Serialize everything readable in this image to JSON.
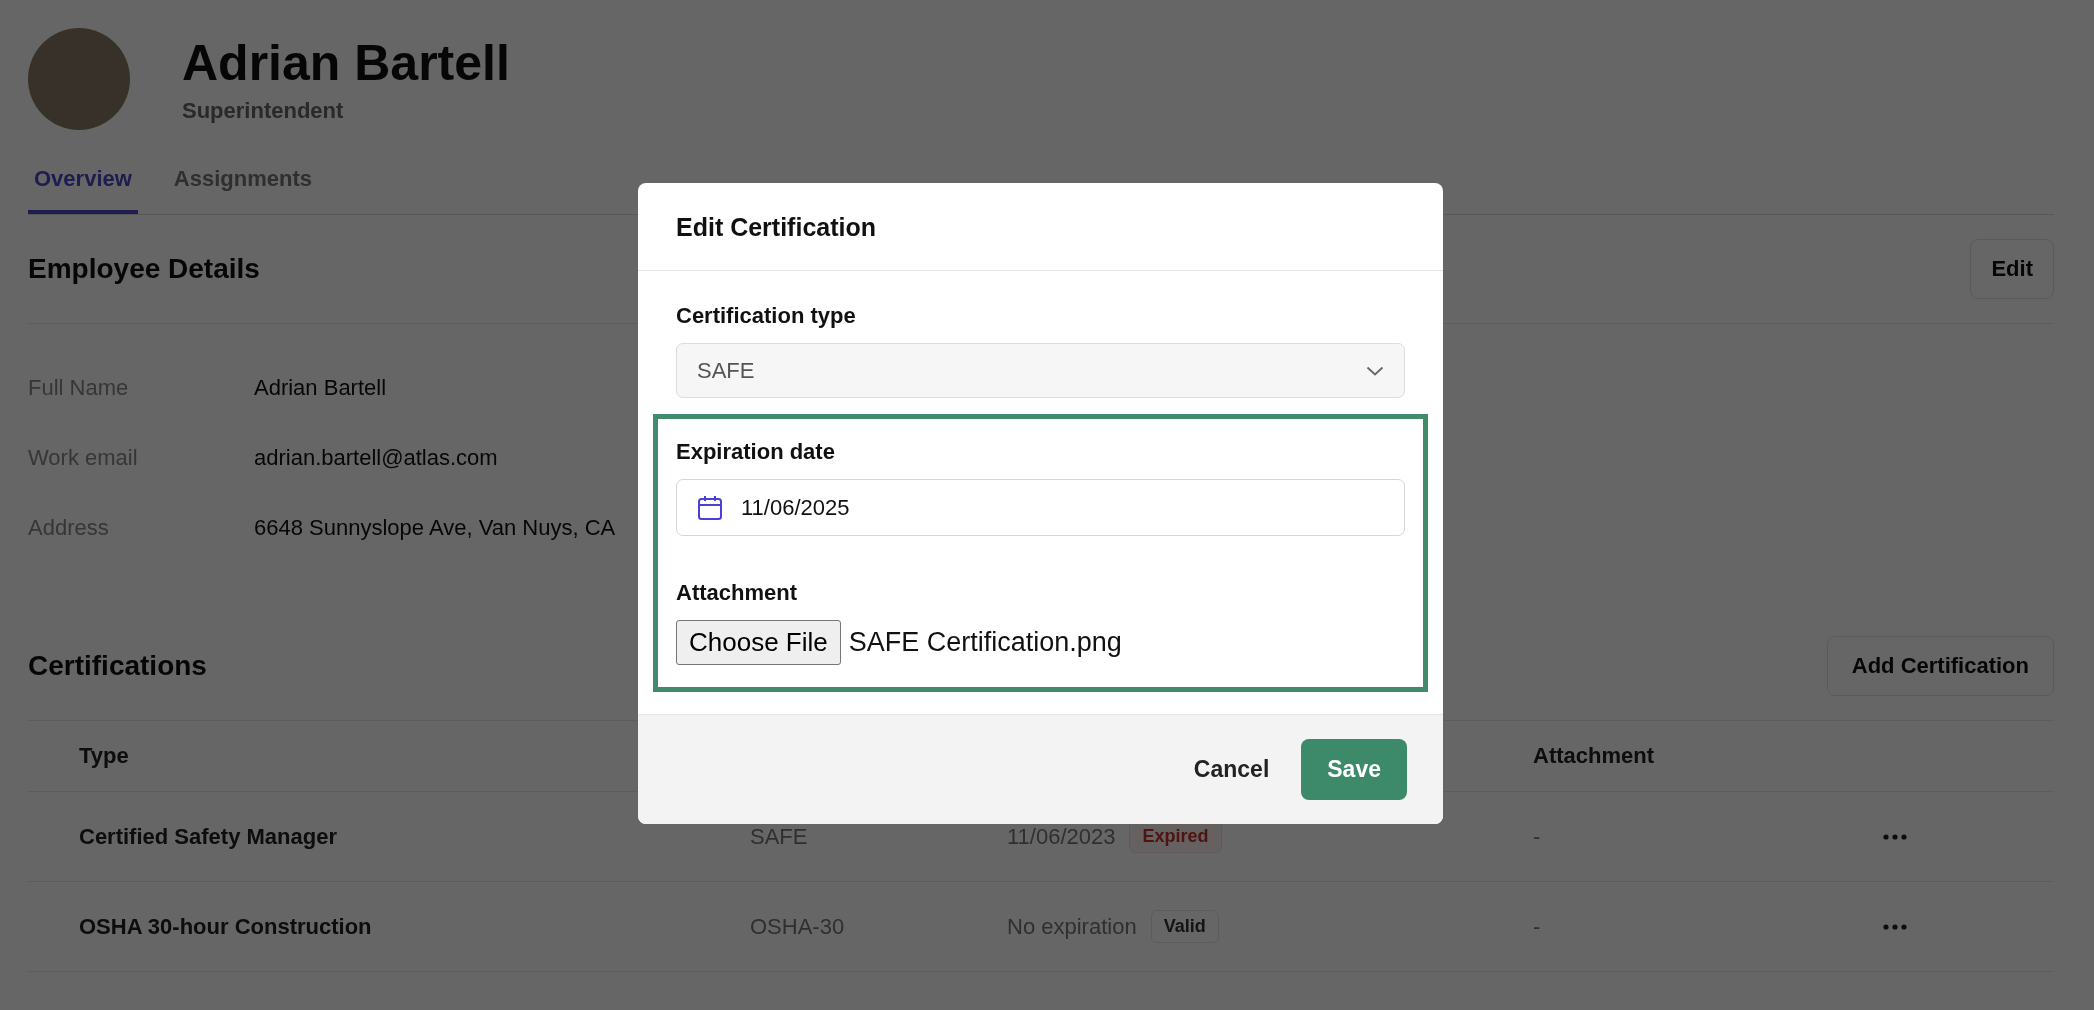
{
  "profile": {
    "name": "Adrian Bartell",
    "role": "Superintendent"
  },
  "tabs": [
    {
      "label": "Overview",
      "selected": true
    },
    {
      "label": "Assignments",
      "selected": false
    }
  ],
  "employee_details": {
    "title": "Employee Details",
    "edit_button": "Edit",
    "fields": [
      {
        "label": "Full Name",
        "value": "Adrian Bartell"
      },
      {
        "label": "Work email",
        "value": "adrian.bartell@atlas.com"
      },
      {
        "label": "Address",
        "value": "6648 Sunnyslope Ave, Van Nuys, CA"
      }
    ]
  },
  "certifications": {
    "title": "Certifications",
    "add_button": "Add Certification",
    "columns": [
      {
        "label": "Type"
      },
      {
        "label": "Attachment"
      }
    ],
    "rows": [
      {
        "type": "Certified Safety Manager",
        "code": "SAFE",
        "expiration": "11/06/2023",
        "status": {
          "label": "Expired",
          "kind": "expired"
        },
        "attachment": "-"
      },
      {
        "type": "OSHA 30-hour Construction",
        "code": "OSHA-30",
        "expiration": "No expiration",
        "status": {
          "label": "Valid",
          "kind": "valid"
        },
        "attachment": "-"
      }
    ]
  },
  "modal": {
    "title": "Edit Certification",
    "type_field": {
      "label": "Certification type",
      "value": "SAFE"
    },
    "highlighted": true,
    "expiration_field": {
      "label": "Expiration date",
      "value": "11/06/2025"
    },
    "attachment_field": {
      "label": "Attachment",
      "button": "Choose File",
      "file_name": "SAFE Certification.png"
    },
    "buttons": {
      "cancel": "Cancel",
      "save": "Save"
    }
  }
}
